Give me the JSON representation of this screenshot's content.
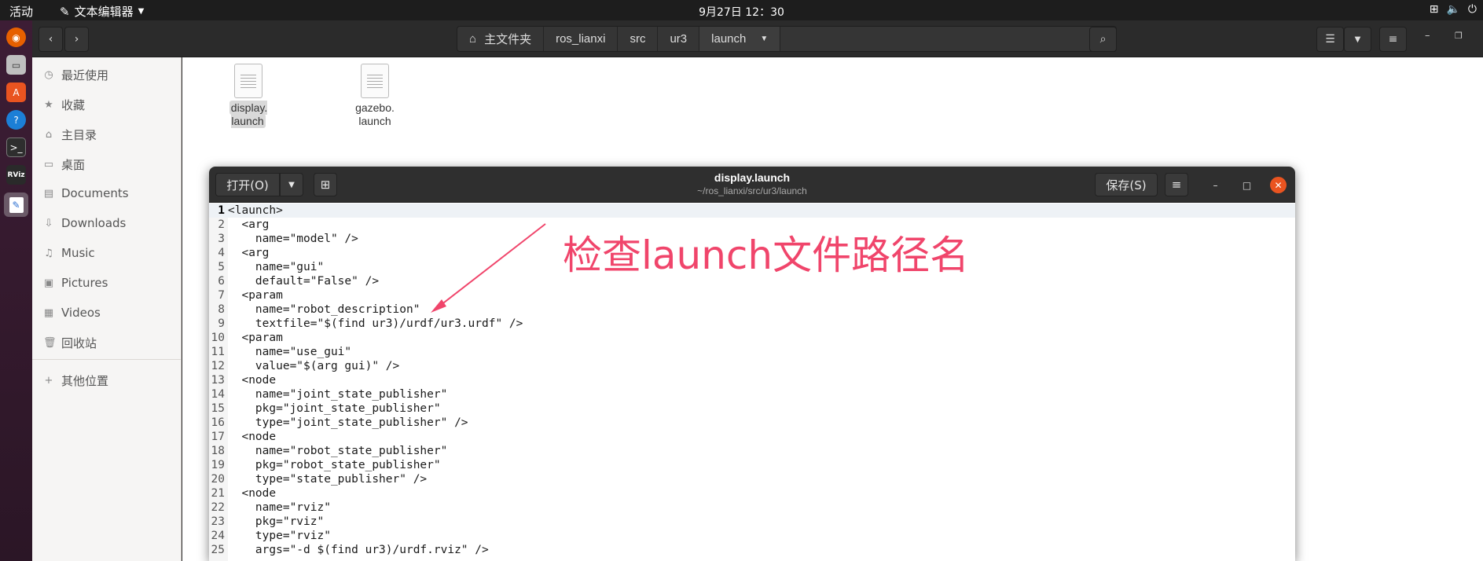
{
  "topbar": {
    "activities": "活动",
    "app_name": "文本编辑器",
    "clock": "9月27日  12：30"
  },
  "dock": {
    "items": [
      "firefox-icon",
      "files-icon",
      "software-icon",
      "help-icon",
      "terminal-icon",
      "rviz-icon",
      "text-editor-icon"
    ]
  },
  "file_manager": {
    "breadcrumbs": [
      "主文件夹",
      "ros_lianxi",
      "src",
      "ur3",
      "launch"
    ],
    "sidebar": [
      {
        "label": "最近使用",
        "icon": "clock-icon"
      },
      {
        "label": "收藏",
        "icon": "star-icon"
      },
      {
        "label": "主目录",
        "icon": "home-icon"
      },
      {
        "label": "桌面",
        "icon": "desktop-icon"
      },
      {
        "label": "Documents",
        "icon": "document-icon"
      },
      {
        "label": "Downloads",
        "icon": "download-icon"
      },
      {
        "label": "Music",
        "icon": "music-icon"
      },
      {
        "label": "Pictures",
        "icon": "picture-icon"
      },
      {
        "label": "Videos",
        "icon": "video-icon"
      },
      {
        "label": "回收站",
        "icon": "trash-icon"
      },
      {
        "label": "其他位置",
        "icon": "plus-icon"
      }
    ],
    "files": [
      {
        "line1": "display.",
        "line2": "launch",
        "selected": true
      },
      {
        "line1": "gazebo.",
        "line2": "launch",
        "selected": false
      }
    ]
  },
  "editor": {
    "open_label": "打开(O)",
    "save_label": "保存(S)",
    "title": "display.launch",
    "subtitle": "~/ros_lianxi/src/ur3/launch",
    "lines": [
      "<launch>",
      "  <arg",
      "    name=\"model\" />",
      "  <arg",
      "    name=\"gui\"",
      "    default=\"False\" />",
      "  <param",
      "    name=\"robot_description\"",
      "    textfile=\"$(find ur3)/urdf/ur3.urdf\" />",
      "  <param",
      "    name=\"use_gui\"",
      "    value=\"$(arg gui)\" />",
      "  <node",
      "    name=\"joint_state_publisher\"",
      "    pkg=\"joint_state_publisher\"",
      "    type=\"joint_state_publisher\" />",
      "  <node",
      "    name=\"robot_state_publisher\"",
      "    pkg=\"robot_state_publisher\"",
      "    type=\"state_publisher\" />",
      "  <node",
      "    name=\"rviz\"",
      "    pkg=\"rviz\"",
      "    type=\"rviz\"",
      "    args=\"-d $(find ur3)/urdf.rviz\" />"
    ]
  },
  "annotation": {
    "text": "检查launch文件路径名",
    "color": "#f0456b"
  }
}
